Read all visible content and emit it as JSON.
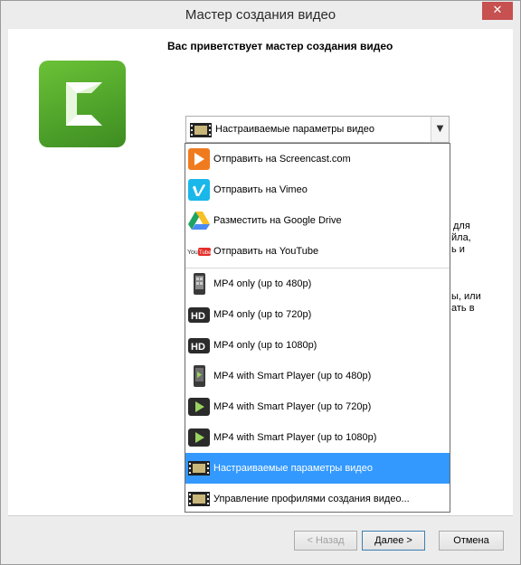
{
  "window": {
    "title": "Мастер создания видео",
    "close_glyph": "✕"
  },
  "page": {
    "heading": "Вас приветствует мастер создания видео"
  },
  "background_text": {
    "fragments": [
      "для",
      "йла,",
      "ь и",
      "ы, или",
      "ать в"
    ]
  },
  "combo": {
    "selected": "Настраиваемые параметры видео",
    "icon": "film-icon",
    "arrow": "v"
  },
  "dropdown": {
    "items": [
      {
        "label": "Отправить на Screencast.com",
        "icon": "screencast-icon"
      },
      {
        "label": "Отправить на Vimeo",
        "icon": "vimeo-icon"
      },
      {
        "label": "Разместить на Google Drive",
        "icon": "google-drive-icon"
      },
      {
        "label": "Отправить на YouTube",
        "icon": "youtube-icon"
      },
      {
        "label": "MP4 only (up to 480p)",
        "icon": "mobile-phone-icon"
      },
      {
        "label": "MP4 only (up to 720p)",
        "icon": "hd-icon"
      },
      {
        "label": "MP4 only (up to 1080p)",
        "icon": "hd-icon"
      },
      {
        "label": "MP4 with Smart Player (up to 480p)",
        "icon": "phone-play-icon"
      },
      {
        "label": "MP4 with Smart Player (up to 720p)",
        "icon": "play-icon"
      },
      {
        "label": "MP4 with Smart Player (up to 1080p)",
        "icon": "play-icon"
      },
      {
        "label": "Настраиваемые параметры видео",
        "icon": "film-icon",
        "selected": true
      },
      {
        "label": "Управление профилями создания видео...",
        "icon": "film-icon"
      }
    ],
    "youtube_logo_text": "YouTube",
    "hd_text": "HD"
  },
  "footer": {
    "back": "< Назад",
    "next": "Далее >",
    "cancel": "Отмена"
  },
  "colors": {
    "selection": "#3399ff",
    "logo_green": "#5aae2e",
    "close_red": "#c75050"
  }
}
